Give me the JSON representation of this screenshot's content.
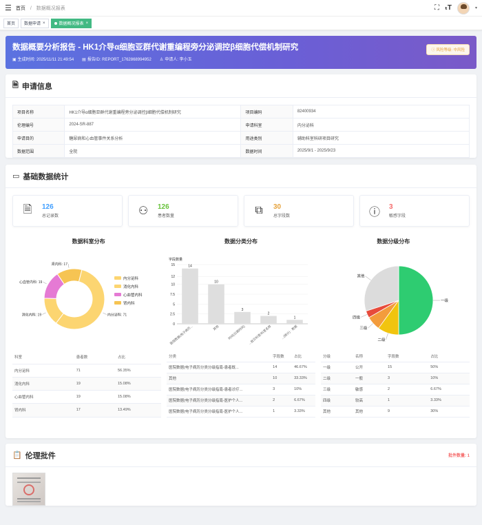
{
  "topbar": {
    "menu_icon": "hamburger-icon",
    "breadcrumb": [
      "首页",
      "数据概况报表"
    ],
    "fullscreen_icon": "fullscreen-icon",
    "font_size_icon": "font-size-icon"
  },
  "tabs": [
    {
      "label": "首页",
      "closable": false,
      "active": false
    },
    {
      "label": "数据申请",
      "closable": true,
      "active": false
    },
    {
      "label": "数据概况报表",
      "closable": true,
      "active": true
    }
  ],
  "hero": {
    "title": "数据概要分析报告 - HK1介导α细胞亚群代谢重编程旁分泌调控β细胞代偿机制研究",
    "generated": "生成时间: 2025/11/11 21:49:54",
    "report_id": "报告ID: REPORT_1762868994952",
    "applicant": "申请人: 李小玉",
    "risk": "风险等级: 中风险"
  },
  "application": {
    "title": "申请信息",
    "rows": [
      [
        "项目名称",
        "HK1介导α细胞亚群代谢重编程旁分泌调控β细胞代偿机制研究",
        "项目编码",
        "82400934"
      ],
      [
        "伦理编号",
        "2024-SR-887",
        "申请科室",
        "内分泌科"
      ],
      [
        "申请目的",
        "糖尿病和心血管事件关系分析",
        "用途类别",
        "辅助科室科研项目研究"
      ],
      [
        "数据范围",
        "全院",
        "数据时间",
        "2025/9/1 - 2025/9/23"
      ]
    ]
  },
  "stats": {
    "title": "基础数据统计",
    "cards": [
      {
        "value": "126",
        "label": "总记录数",
        "color": "#409eff",
        "icon": "document-icon"
      },
      {
        "value": "126",
        "label": "患者数量",
        "color": "#67c23a",
        "icon": "user-icon"
      },
      {
        "value": "30",
        "label": "总字段数",
        "color": "#e6a23c",
        "icon": "fields-icon"
      },
      {
        "value": "3",
        "label": "敏感字段",
        "color": "#f56c6c",
        "icon": "warning-icon"
      }
    ]
  },
  "chart_data": [
    {
      "type": "pie",
      "title": "数据科室分布",
      "categories": [
        "内分泌科",
        "消化内科",
        "心血管内科",
        "肾内科"
      ],
      "values": [
        71,
        19,
        19,
        17
      ],
      "colors": [
        "#fbd46d",
        "#fbd46d",
        "#e57ad4",
        "#f5c04e"
      ],
      "slice_labels": [
        "内分泌科: 71",
        "消化内科: 19",
        "心血管内科: 19",
        "肾内科: 17"
      ],
      "legend": "right"
    },
    {
      "type": "bar",
      "title": "数据分类分布",
      "ylabel": "字段数量",
      "categories": [
        "医院数据(电子病历分类分级其他)",
        "其他",
        "医院数据(电子病历分类分级...",
        "医院数据(电子病历分类分级...",
        "医院数据(电子病历分类分级..."
      ],
      "tick_labels": [
        "医院数据(电子病历...",
        "其他",
        "时间(日期时间)",
        "...就诊科室/科室名称",
        "...(统计) · 数据"
      ],
      "values": [
        14,
        10,
        3,
        2,
        1
      ],
      "ylim": [
        0,
        15
      ],
      "yticks": [
        0,
        2.5,
        5,
        7.5,
        10,
        12,
        15
      ]
    },
    {
      "type": "pie",
      "title": "数据分级分布",
      "categories": [
        "一级",
        "二级",
        "三级",
        "四级",
        "其他"
      ],
      "values": [
        15,
        3,
        2,
        1,
        9
      ],
      "colors": [
        "#2ecc71",
        "#f1c40f",
        "#f39c3c",
        "#e74c3c",
        "#dcdcdc"
      ]
    }
  ],
  "dept_table": {
    "headers": [
      "科室",
      "患者数",
      "占比"
    ],
    "rows": [
      [
        "内分泌科",
        "71",
        "56.35%"
      ],
      [
        "消化内科",
        "19",
        "15.08%"
      ],
      [
        "心血管内科",
        "19",
        "15.08%"
      ],
      [
        "肾内科",
        "17",
        "13.49%"
      ]
    ]
  },
  "category_table": {
    "headers": [
      "分类",
      "字段数",
      "占比"
    ],
    "rows": [
      [
        "医院数据(电子病历分类分级指南-患者既...",
        "14",
        "46.67%"
      ],
      [
        "其他",
        "10",
        "33.33%"
      ],
      [
        "医院数据(电子病历分类分级指南-患者诊疗...",
        "3",
        "10%"
      ],
      [
        "医院数据(电子病历分类分级指南-医护个人...",
        "2",
        "6.67%"
      ],
      [
        "医院数据(电子病历分类分级指南-医护个人...",
        "1",
        "3.33%"
      ]
    ]
  },
  "level_table": {
    "headers": [
      "分级",
      "名称",
      "字段数",
      "占比"
    ],
    "rows": [
      [
        "一级",
        "公开",
        "15",
        "50%"
      ],
      [
        "二级",
        "一般",
        "3",
        "10%"
      ],
      [
        "三级",
        "敏感",
        "2",
        "6.67%"
      ],
      [
        "四级",
        "较高",
        "1",
        "3.33%"
      ],
      [
        "其他",
        "其他",
        "9",
        "30%"
      ]
    ]
  },
  "ethics": {
    "title": "伦理批件",
    "count": "批件数量: 1"
  }
}
